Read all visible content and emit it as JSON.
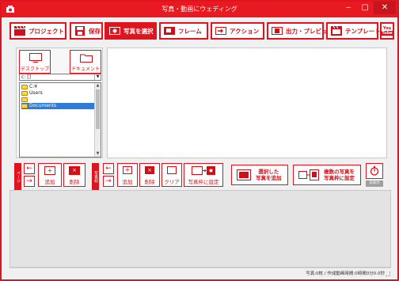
{
  "window": {
    "title": "写真・動画にウェディング",
    "min": "‒",
    "max": "▢",
    "close": "✕"
  },
  "toolbar": {
    "project": "プロジェクト",
    "save": "保存",
    "select_photo": "写真を選択",
    "frame": "フレーム",
    "action": "アクション",
    "output_preview": "出力・プレビュー",
    "template": "テンプレート",
    "youtube_top": "You",
    "youtube_bottom": "Tube"
  },
  "left_panel": {
    "desktop": "デスクトップ",
    "documents": "ドキュメント",
    "drive": "c: []",
    "tree": [
      "C:¥",
      "Users",
      "",
      "Documents"
    ]
  },
  "page_group": {
    "tag": "ページ",
    "add": "追加",
    "delete": "削除"
  },
  "frame_group": {
    "tag": "写真枠",
    "add": "追加",
    "delete": "削除",
    "clear": "クリア",
    "set_photo": "写真枠に設定"
  },
  "actions": {
    "add_selected_line1": "選択した",
    "add_selected_line2": "写真を追加",
    "set_multiple_line1": "複数の写真を",
    "set_multiple_line2": "写真枠に設定",
    "timer_label": "非表示"
  },
  "status": {
    "text": "写真:0枚 / 作成動画時間:0時間0分0.0秒"
  }
}
